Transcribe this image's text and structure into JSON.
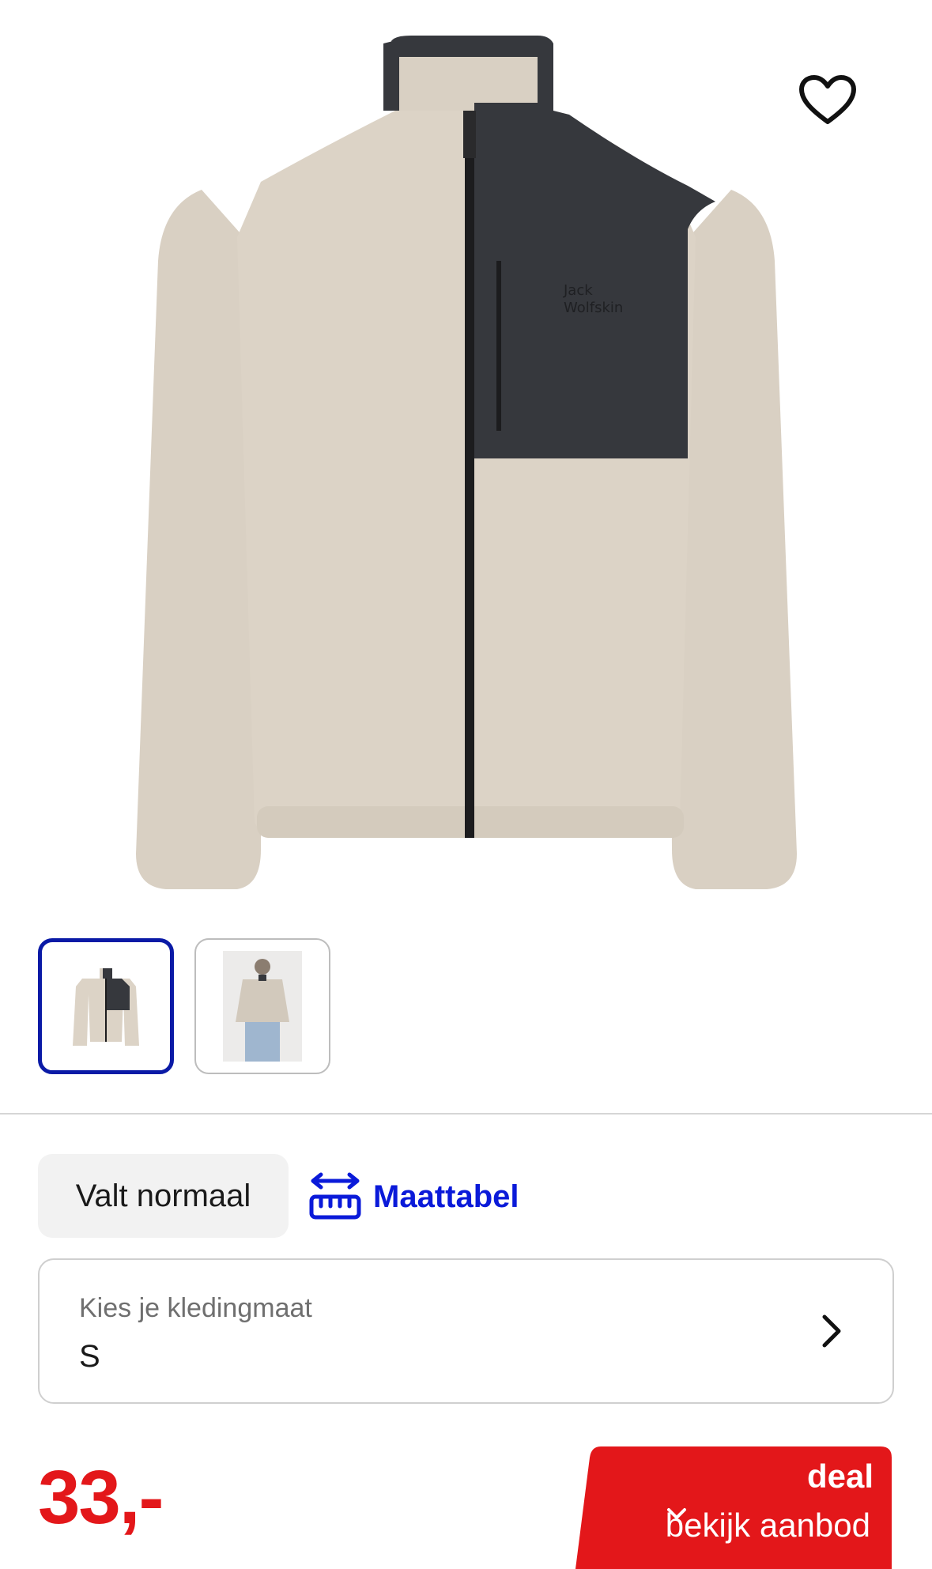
{
  "product": {
    "image_alt": "fleece-jacket-product-photo",
    "colors": {
      "fleece": "#d9d0c3",
      "panel": "#36383d",
      "zipper": "#1c1c1e"
    }
  },
  "wishlist": {
    "icon": "heart-icon"
  },
  "thumbnails": [
    {
      "name": "front-view",
      "active": true
    },
    {
      "name": "back-view-model",
      "active": false
    }
  ],
  "fit": {
    "label": "Valt normaal"
  },
  "size_chart": {
    "label": "Maattabel",
    "icon": "ruler-icon",
    "color": "#0a1ad9"
  },
  "size_select": {
    "label": "Kies je kledingmaat",
    "value": "S",
    "icon": "chevron-right-icon"
  },
  "price": {
    "value": "33,-",
    "color": "#e3171a"
  },
  "deal": {
    "badge": "deal",
    "cta": "bekijk aanbod",
    "icon": "chevron-down-icon",
    "color": "#e3171a"
  }
}
